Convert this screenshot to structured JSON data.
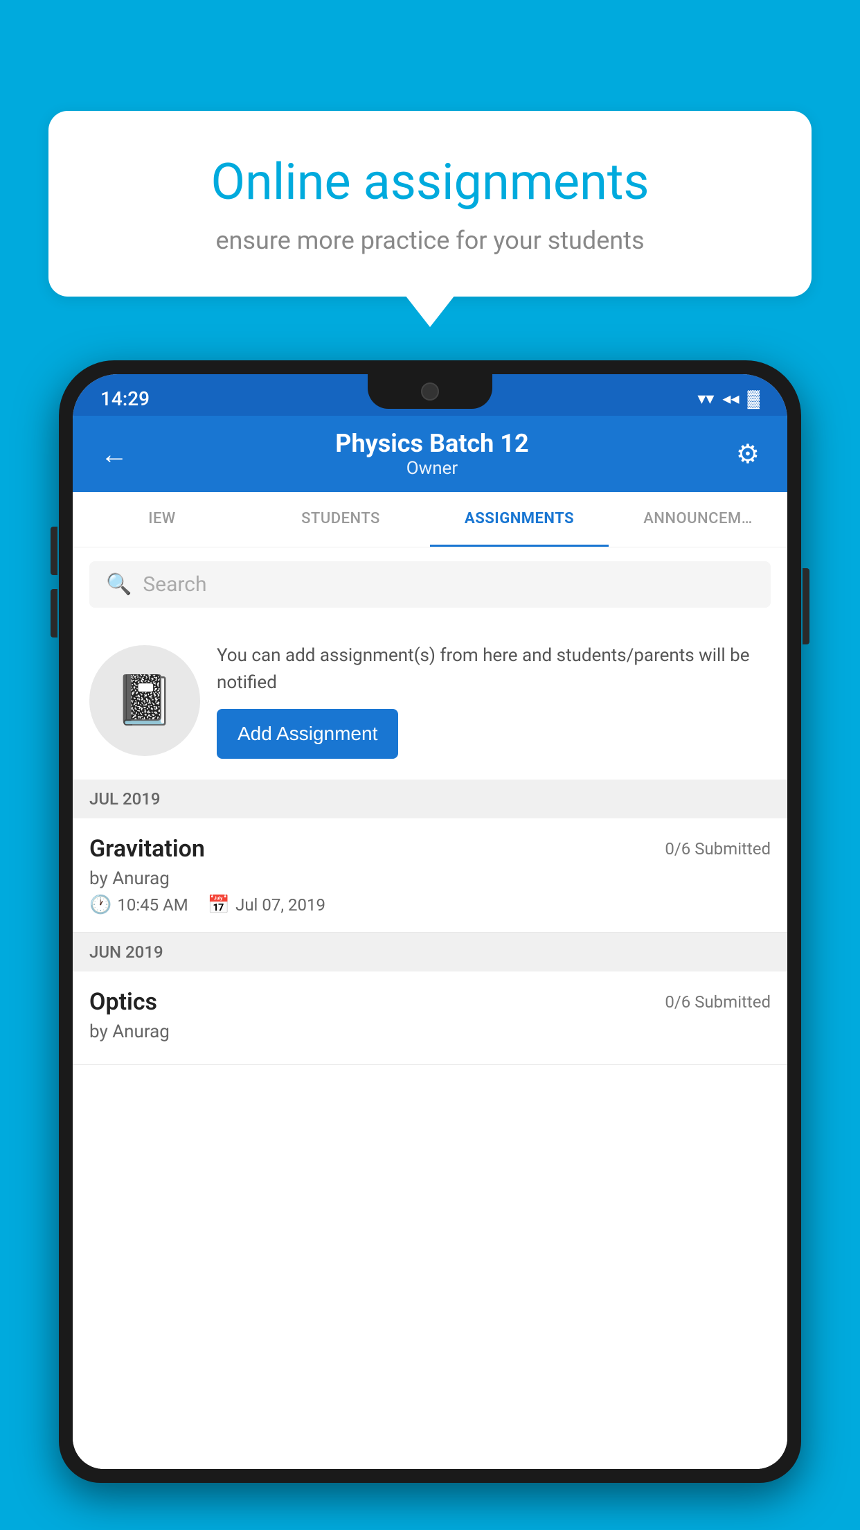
{
  "background_color": "#00AADD",
  "speech_bubble": {
    "title": "Online assignments",
    "subtitle": "ensure more practice for your students"
  },
  "status_bar": {
    "time": "14:29",
    "wifi": "▲",
    "signal": "▲",
    "battery": "▓"
  },
  "app_bar": {
    "back_label": "←",
    "title": "Physics Batch 12",
    "subtitle": "Owner",
    "settings_label": "⚙"
  },
  "tabs": [
    {
      "id": "iew",
      "label": "IEW",
      "active": false
    },
    {
      "id": "students",
      "label": "STUDENTS",
      "active": false
    },
    {
      "id": "assignments",
      "label": "ASSIGNMENTS",
      "active": true
    },
    {
      "id": "announcements",
      "label": "ANNOUNCEM...",
      "active": false
    }
  ],
  "search": {
    "placeholder": "Search"
  },
  "promo": {
    "description": "You can add assignment(s) from here and students/parents will be notified",
    "button_label": "Add Assignment"
  },
  "sections": [
    {
      "label": "JUL 2019",
      "assignments": [
        {
          "title": "Gravitation",
          "status": "0/6 Submitted",
          "author": "by Anurag",
          "time": "10:45 AM",
          "date": "Jul 07, 2019"
        }
      ]
    },
    {
      "label": "JUN 2019",
      "assignments": [
        {
          "title": "Optics",
          "status": "0/6 Submitted",
          "author": "by Anurag",
          "time": "",
          "date": ""
        }
      ]
    }
  ]
}
